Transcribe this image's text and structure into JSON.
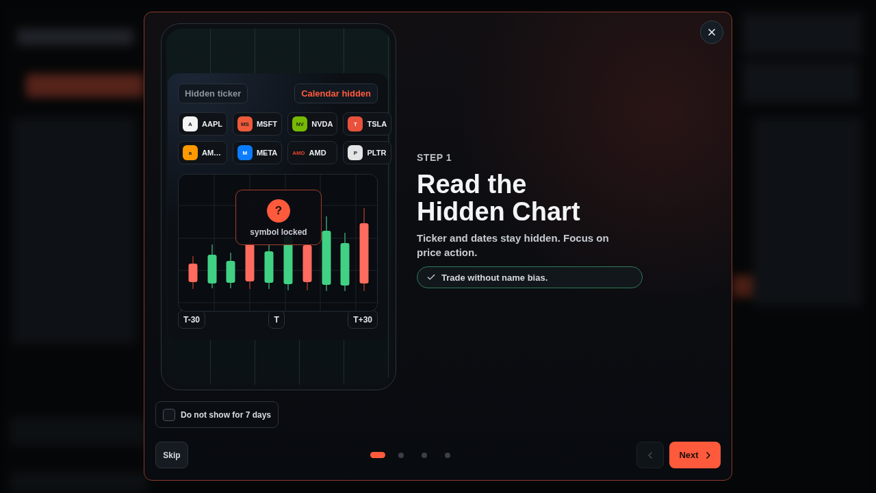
{
  "preview": {
    "chips": [
      {
        "label": "Hidden ticker",
        "color": "#8c949d"
      },
      {
        "label": "Calendar hidden",
        "color": "#ff5b3d"
      }
    ],
    "tickers": [
      {
        "symbol": "AAPL",
        "logo": "A",
        "kind": "tile",
        "color": "#f4f4f4"
      },
      {
        "symbol": "MSFT",
        "logo": "MS",
        "kind": "tile",
        "color": "#ee5a3a"
      },
      {
        "symbol": "NVDA",
        "logo": "NV",
        "kind": "tile",
        "color": "#76b900"
      },
      {
        "symbol": "TSLA",
        "logo": "T",
        "kind": "tile",
        "color": "#e8513c"
      },
      {
        "symbol": "AM…",
        "logo": "a",
        "kind": "tile",
        "color": "#ff9900"
      },
      {
        "symbol": "META",
        "logo": "M",
        "kind": "tile",
        "color": "#0a7cff"
      },
      {
        "symbol": "AMD",
        "logo": "AMD",
        "kind": "wordmark",
        "color": "#e4432d"
      },
      {
        "symbol": "PLTR",
        "logo": "P",
        "kind": "tile",
        "color": "#e2e4e6"
      }
    ],
    "locked_overlay": {
      "icon": "?",
      "label": "symbol locked"
    },
    "axis_labels": [
      "T-30",
      "T",
      "T+30"
    ]
  },
  "step": {
    "eyebrow": "STEP 1",
    "title": "Read the Hidden Chart",
    "description": "Ticker and dates stay hidden. Focus on price action.",
    "highlight": "Trade without name bias."
  },
  "dont_show": {
    "label": "Do not show for 7 days",
    "checked": false
  },
  "footer": {
    "skip": "Skip",
    "pages": [
      {
        "selected": true
      },
      {
        "selected": false
      },
      {
        "selected": false
      },
      {
        "selected": false
      }
    ],
    "previous": {
      "disabled": true
    },
    "next": {
      "label": "Next",
      "disabled": false
    }
  }
}
